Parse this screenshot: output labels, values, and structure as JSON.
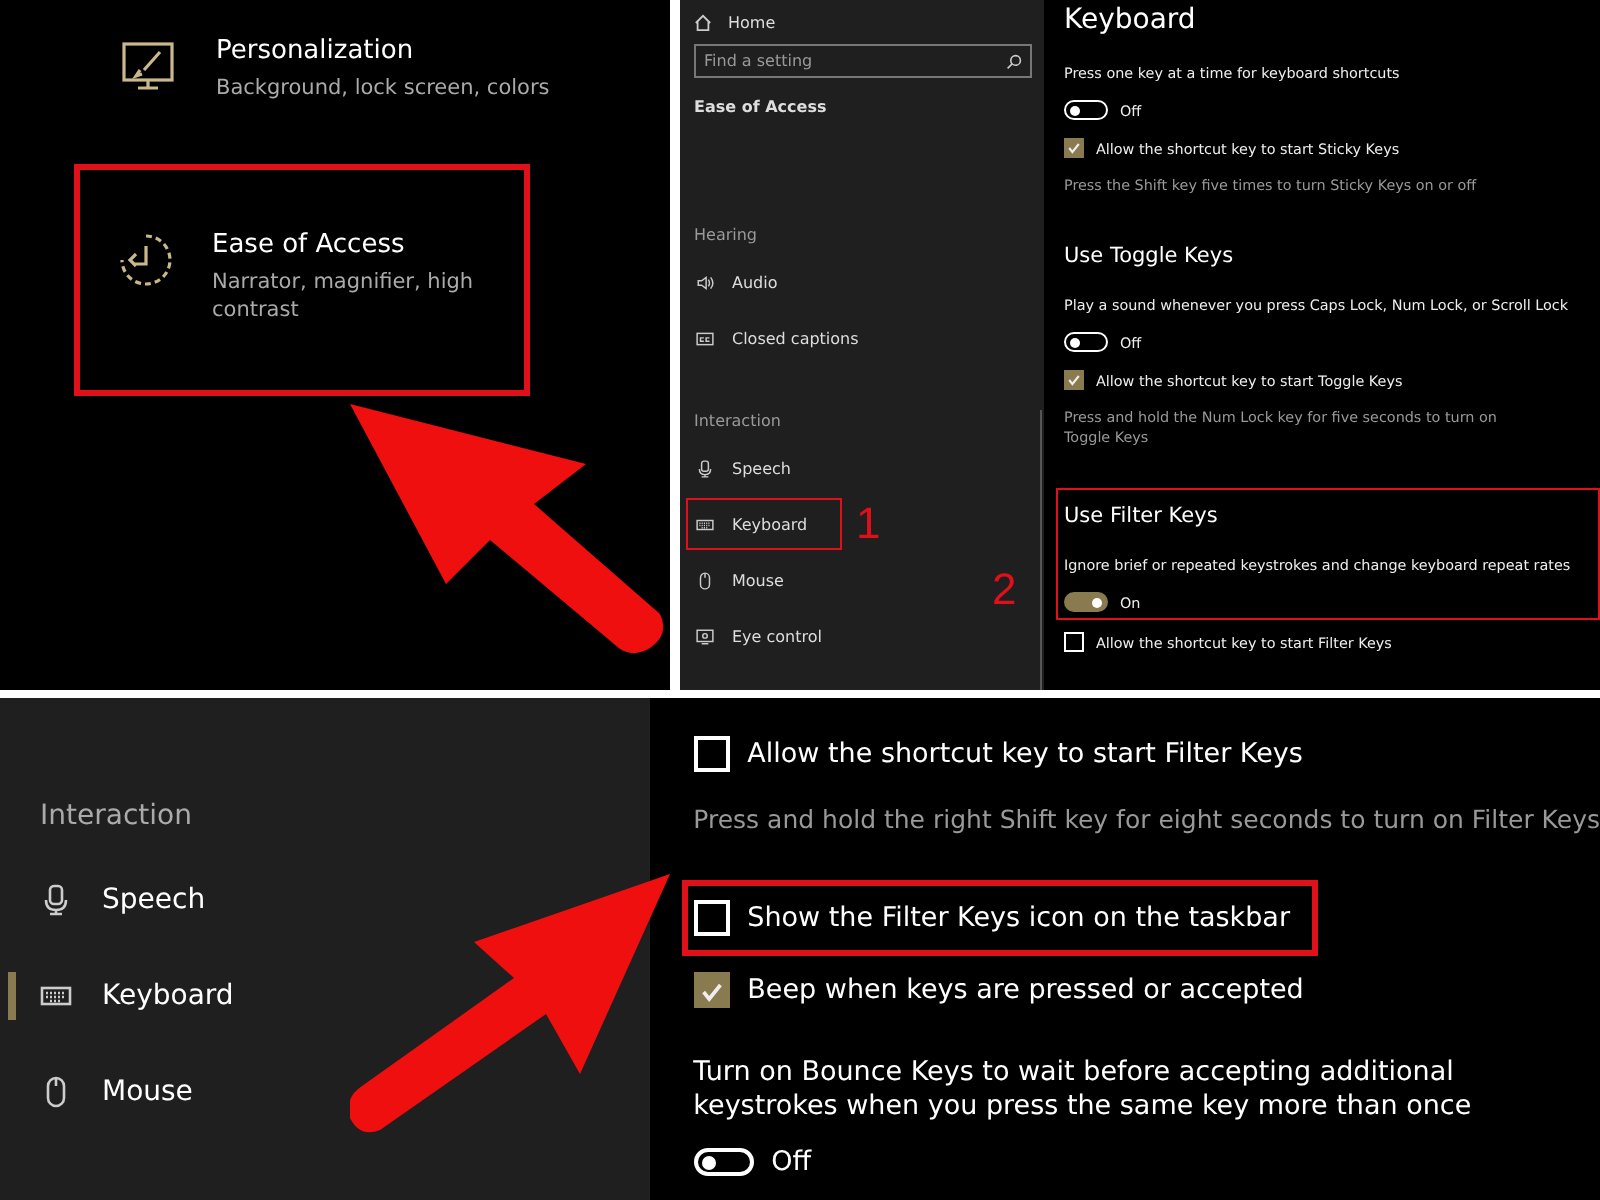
{
  "start_tiles": [
    {
      "title": "Personalization",
      "subtitle": "Background, lock screen, colors",
      "highlighted": false
    },
    {
      "title": "Ease of Access",
      "subtitle": "Narrator, magnifier, high contrast",
      "highlighted": true
    }
  ],
  "settings_window": {
    "sidebar": {
      "home": "Home",
      "search": {
        "placeholder": "Find a setting"
      },
      "section_title": "Ease of Access",
      "groups": [
        {
          "heading": "Hearing",
          "items": [
            {
              "label": "Audio",
              "selected": false,
              "highlighted": false
            },
            {
              "label": "Closed captions",
              "selected": false,
              "highlighted": false
            }
          ]
        },
        {
          "heading": "Interaction",
          "items": [
            {
              "label": "Speech",
              "selected": false,
              "highlighted": false
            },
            {
              "label": "Keyboard",
              "selected": false,
              "highlighted": true,
              "marker": "1"
            },
            {
              "label": "Mouse",
              "selected": false,
              "highlighted": false
            },
            {
              "label": "Eye control",
              "selected": false,
              "highlighted": false
            }
          ]
        }
      ]
    },
    "content": {
      "title": "Keyboard",
      "sections": [
        {
          "highlighted": false,
          "rows": [
            {
              "kind": "text",
              "text": "Press one key at a time for keyboard shortcuts"
            },
            {
              "kind": "toggle",
              "on": false,
              "label": "Off"
            },
            {
              "kind": "checkbox",
              "checked": true,
              "label": "Allow the shortcut key to start Sticky Keys"
            },
            {
              "kind": "hint",
              "text": "Press the Shift key five times to turn Sticky Keys on or off"
            }
          ]
        },
        {
          "heading": "Use Toggle Keys",
          "highlighted": false,
          "rows": [
            {
              "kind": "text",
              "text": "Play a sound whenever you press Caps Lock, Num Lock, or Scroll Lock"
            },
            {
              "kind": "toggle",
              "on": false,
              "label": "Off"
            },
            {
              "kind": "checkbox",
              "checked": true,
              "label": "Allow the shortcut key to start Toggle Keys"
            },
            {
              "kind": "hint",
              "text": "Press and hold the Num Lock key for five seconds to turn on Toggle Keys"
            }
          ]
        },
        {
          "heading": "Use Filter Keys",
          "highlighted": true,
          "marker": "2",
          "rows": [
            {
              "kind": "text",
              "text": "Ignore brief or repeated keystrokes and change keyboard repeat rates"
            },
            {
              "kind": "toggle",
              "on": true,
              "label": "On"
            }
          ]
        },
        {
          "highlighted": false,
          "rows": [
            {
              "kind": "checkbox",
              "checked": false,
              "label": "Allow the shortcut key to start Filter Keys"
            }
          ]
        }
      ]
    }
  },
  "detail_view": {
    "sidebar": {
      "heading": "Interaction",
      "items": [
        {
          "label": "Speech",
          "selected": false
        },
        {
          "label": "Keyboard",
          "selected": true
        },
        {
          "label": "Mouse",
          "selected": false
        }
      ]
    },
    "rows": [
      {
        "kind": "checkbox",
        "checked": false,
        "highlighted": false,
        "label": "Allow the shortcut key to start Filter Keys"
      },
      {
        "kind": "hint",
        "highlighted": false,
        "text": "Press and hold the right Shift key for eight seconds to turn on Filter Keys"
      },
      {
        "kind": "checkbox",
        "checked": false,
        "highlighted": true,
        "label": "Show the Filter Keys icon on the taskbar"
      },
      {
        "kind": "checkbox",
        "checked": true,
        "highlighted": false,
        "label": "Beep when keys are pressed or accepted"
      },
      {
        "kind": "text",
        "highlighted": false,
        "text": "Turn on Bounce Keys to wait before accepting additional keystrokes when you press the same key more than once"
      },
      {
        "kind": "toggle",
        "on": false,
        "highlighted": false,
        "label": "Off"
      }
    ]
  }
}
